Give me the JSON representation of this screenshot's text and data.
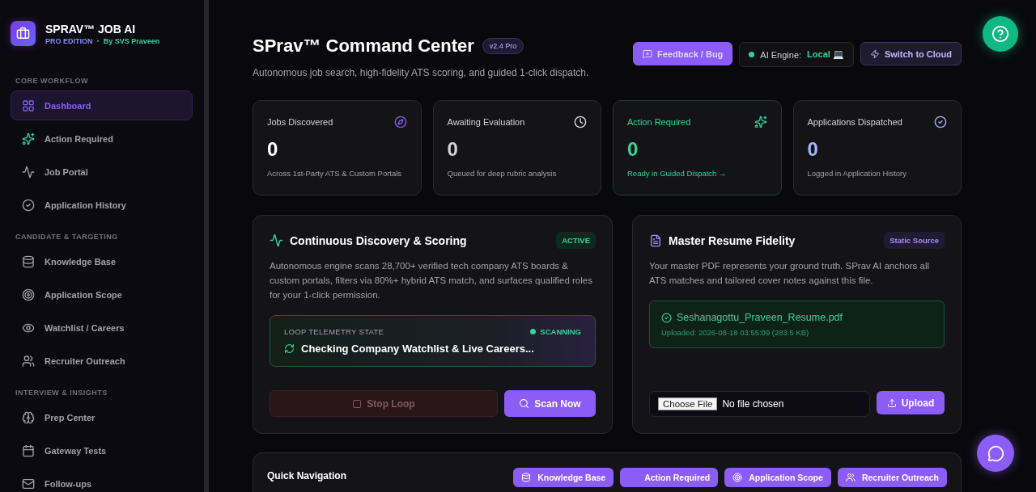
{
  "brand": {
    "title": "SPRAV™ JOB AI",
    "edition": "PRO EDITION",
    "separator": "•",
    "author": "By SVS Praveen"
  },
  "sidebar": {
    "sections": [
      {
        "heading": "CORE WORKFLOW",
        "items": [
          {
            "label": "Dashboard",
            "selected": true
          },
          {
            "label": "Action Required",
            "selected": false
          },
          {
            "label": "Job Portal",
            "selected": false
          },
          {
            "label": "Application History",
            "selected": false
          }
        ]
      },
      {
        "heading": "CANDIDATE & TARGETING",
        "items": [
          {
            "label": "Knowledge Base",
            "selected": false
          },
          {
            "label": "Application Scope",
            "selected": false
          },
          {
            "label": "Watchlist / Careers",
            "selected": false
          },
          {
            "label": "Recruiter Outreach",
            "selected": false
          }
        ]
      },
      {
        "heading": "INTERVIEW & INSIGHTS",
        "items": [
          {
            "label": "Prep Center",
            "selected": false
          },
          {
            "label": "Gateway Tests",
            "selected": false
          },
          {
            "label": "Follow-ups",
            "selected": false
          }
        ]
      }
    ]
  },
  "header": {
    "title": "SPrav™ Command Center",
    "version": "v2.4 Pro",
    "subtitle": "Autonomous job search, high-fidelity ATS scoring, and guided 1-click dispatch.",
    "feedback": "Feedback / Bug",
    "engine_label": "AI Engine:",
    "engine_value": "Local 💻",
    "switch": "Switch to Cloud"
  },
  "stats": [
    {
      "label": "Jobs Discovered",
      "value": "0",
      "note": "Across 1st-Party ATS & Custom Portals",
      "color": "#ffffff"
    },
    {
      "label": "Awaiting Evaluation",
      "value": "0",
      "note": "Queued for deep rubric analysis",
      "color": "#d4d4d8"
    },
    {
      "label": "Action Required",
      "value": "0",
      "note": "Ready in Guided Dispatch →",
      "color": "#34d399"
    },
    {
      "label": "Applications Dispatched",
      "value": "0",
      "note": "Logged in Application History",
      "color": "#a5b4fc"
    }
  ],
  "discovery": {
    "title": "Continuous Discovery & Scoring",
    "badge": "ACTIVE",
    "description": "Autonomous engine scans 28,700+ verified tech company ATS boards & custom portals, filters via 80%+ hybrid ATS match, and surfaces qualified roles for your 1-click permission.",
    "telemetry_label": "LOOP TELEMETRY STATE",
    "telemetry_state": "SCANNING",
    "telemetry_message": "Checking Company Watchlist & Live Careers...",
    "stop": {
      "label": "Stop Loop",
      "disabled": true
    },
    "scan": "Scan Now"
  },
  "resume": {
    "title": "Master Resume Fidelity",
    "badge": "Static Source",
    "description": "Your master PDF represents your ground truth. SPrav AI anchors all ATS matches and tailored cover notes against this file.",
    "file_name": "Seshanagottu_Praveen_Resume.pdf",
    "file_meta": "Uploaded: 2026-08-18 03:55:09 (283.5 KB)",
    "choose": "Choose File",
    "chosen": "No file chosen",
    "upload": "Upload"
  },
  "quick_nav": {
    "title": "Quick Navigation",
    "links": [
      {
        "label": "Knowledge Base"
      },
      {
        "label": "Action Required"
      },
      {
        "label": "Application Scope"
      },
      {
        "label": "Recruiter Outreach"
      }
    ]
  }
}
